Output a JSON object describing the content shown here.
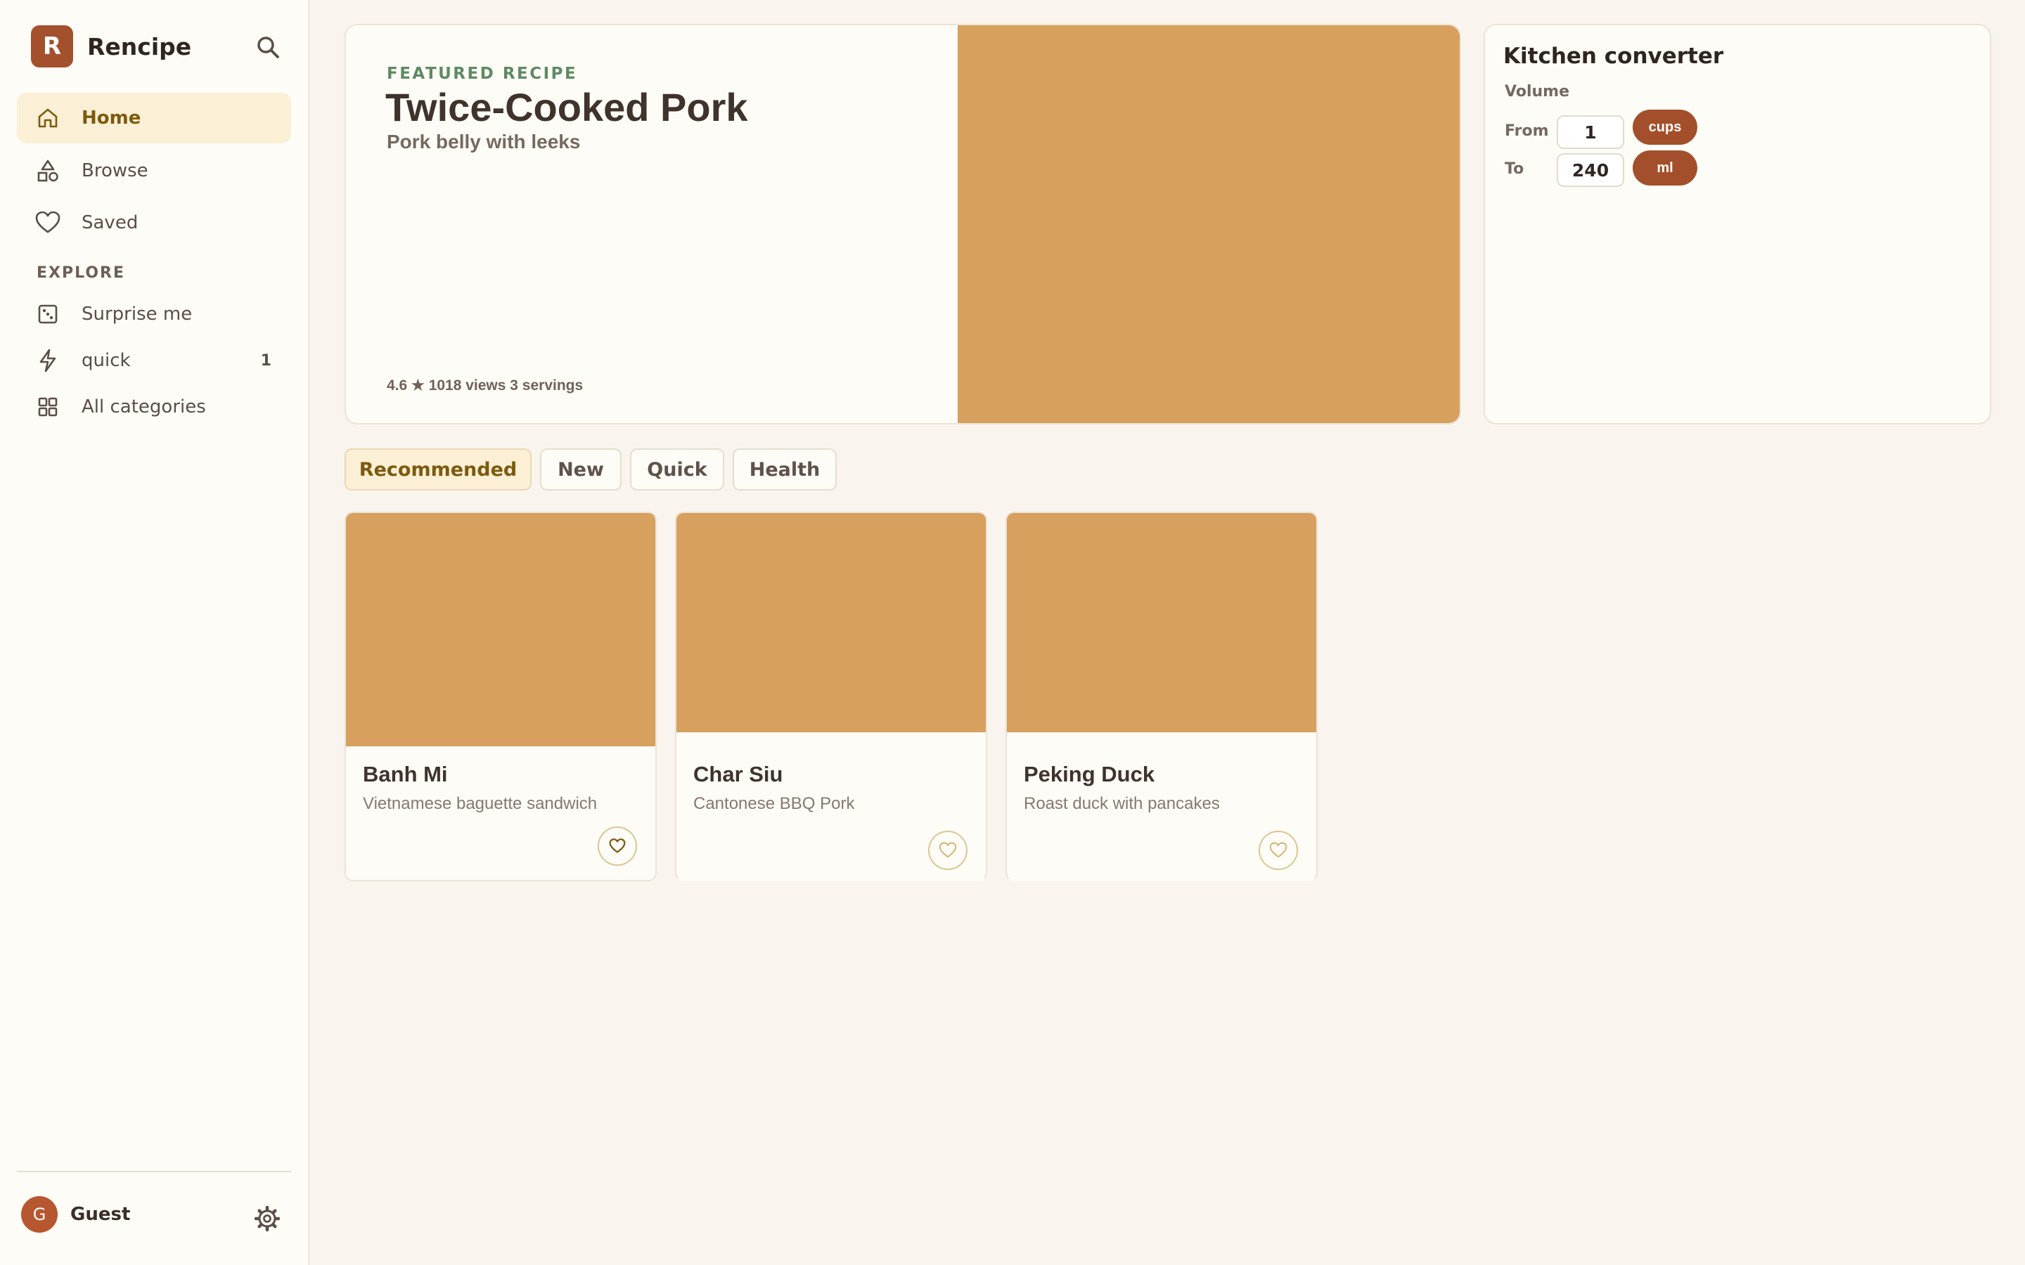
{
  "app": {
    "logo_letter": "R",
    "name": "Rencipe"
  },
  "nav": {
    "home": "Home",
    "browse": "Browse",
    "saved": "Saved",
    "explore_heading": "EXPLORE",
    "surprise": "Surprise me",
    "quick": "quick",
    "quick_count": "1",
    "all_categories": "All categories"
  },
  "user": {
    "initial": "G",
    "name": "Guest"
  },
  "featured": {
    "kicker": "FEATURED RECIPE",
    "title": "Twice-Cooked Pork",
    "subtitle": "Pork belly with leeks",
    "meta": "4.6 ★ 1018 views 3 servings"
  },
  "converter": {
    "title": "Kitchen converter",
    "category": "Volume",
    "from_label": "From",
    "from_value": "1",
    "from_unit": "cups",
    "to_label": "To",
    "to_value": "240",
    "to_unit": "ml"
  },
  "tabs": [
    "Recommended",
    "New",
    "Quick",
    "Health"
  ],
  "active_tab": "Recommended",
  "cards": [
    {
      "title": "Banh Mi",
      "description": "Vietnamese baguette sandwich"
    },
    {
      "title": "Char Siu",
      "description": "Cantonese BBQ Pork"
    },
    {
      "title": "Peking Duck",
      "description": "Roast duck with pancakes"
    }
  ],
  "colors": {
    "accent": "#a4502c",
    "image_placeholder": "#d7a05e",
    "active_nav_bg": "#fbefd5",
    "kicker_green": "#5f8a63"
  },
  "icons": {
    "search": "search-icon",
    "home": "home-icon",
    "browse": "shapes-icon",
    "saved": "heart-icon",
    "surprise": "dice-icon",
    "quick": "bolt-icon",
    "all_categories": "grid-icon",
    "settings": "gear-icon",
    "favorite": "heart-icon"
  }
}
